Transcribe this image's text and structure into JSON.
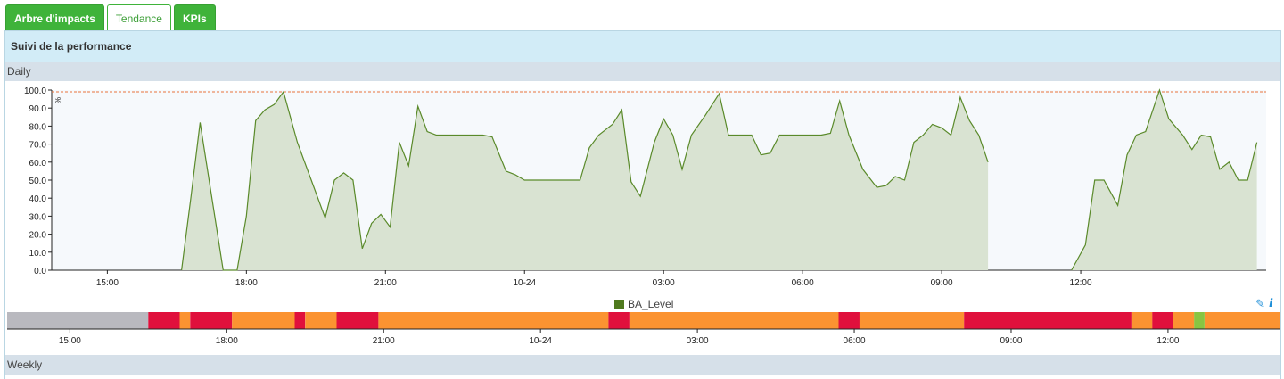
{
  "tabs": [
    {
      "label": "Arbre d'impacts"
    },
    {
      "label": "Tendance"
    },
    {
      "label": "KPIs"
    }
  ],
  "panel": {
    "title": "Suivi de la performance",
    "daily_label": "Daily",
    "weekly_label": "Weekly"
  },
  "colors": {
    "tab_green": "#3fb33a",
    "header_blue": "#d2ecf7",
    "series_line": "#5a8a2a",
    "series_fill": "#d9e3d2",
    "threshold": "#e8733c",
    "status_critical": "#e0103c",
    "status_warning": "#fb9331",
    "status_ok": "#88c542",
    "status_unknown": "#b9b9bf"
  },
  "tools": {
    "edit_icon": "pencil-icon",
    "info_icon": "info-icon",
    "info_glyph": "i"
  },
  "chart_data": {
    "type": "area",
    "title": "",
    "xlabel": "",
    "ylabel": "%",
    "ylim": [
      0,
      100
    ],
    "yticks": [
      "0.0",
      "10.0",
      "20.0",
      "30.0",
      "40.0",
      "50.0",
      "60.0",
      "70.0",
      "80.0",
      "90.0",
      "100.0"
    ],
    "xticks": [
      "15:00",
      "18:00",
      "21:00",
      "10-24",
      "03:00",
      "06:00",
      "09:00",
      "12:00"
    ],
    "threshold": 99,
    "legend": "BA_Level",
    "legend_position": "bottom-center",
    "grid": false,
    "series": [
      {
        "name": "BA_Level",
        "points": [
          [
            16.6,
            0
          ],
          [
            16.8,
            40
          ],
          [
            17.0,
            82
          ],
          [
            17.5,
            0
          ],
          [
            17.8,
            0
          ],
          [
            18.0,
            30
          ],
          [
            18.2,
            83
          ],
          [
            18.4,
            89
          ],
          [
            18.6,
            92
          ],
          [
            18.8,
            99
          ],
          [
            19.1,
            71
          ],
          [
            19.4,
            50
          ],
          [
            19.7,
            29
          ],
          [
            19.9,
            50
          ],
          [
            20.1,
            54
          ],
          [
            20.3,
            50
          ],
          [
            20.5,
            12
          ],
          [
            20.7,
            26
          ],
          [
            20.9,
            31
          ],
          [
            21.1,
            24
          ],
          [
            21.3,
            71
          ],
          [
            21.5,
            58
          ],
          [
            21.7,
            91
          ],
          [
            21.9,
            77
          ],
          [
            22.1,
            75
          ],
          [
            22.3,
            75
          ],
          [
            22.6,
            75
          ],
          [
            22.9,
            75
          ],
          [
            23.1,
            75
          ],
          [
            23.3,
            74
          ],
          [
            23.6,
            55
          ],
          [
            23.8,
            53
          ],
          [
            24.0,
            50
          ],
          [
            24.3,
            50
          ],
          [
            24.6,
            50
          ],
          [
            24.9,
            50
          ],
          [
            25.2,
            50
          ],
          [
            25.4,
            68
          ],
          [
            25.6,
            75
          ],
          [
            25.9,
            81
          ],
          [
            26.1,
            89
          ],
          [
            26.3,
            49
          ],
          [
            26.5,
            41
          ],
          [
            26.8,
            71
          ],
          [
            27.0,
            84
          ],
          [
            27.2,
            75
          ],
          [
            27.4,
            56
          ],
          [
            27.6,
            75
          ],
          [
            27.9,
            86
          ],
          [
            28.2,
            98
          ],
          [
            28.4,
            75
          ],
          [
            28.7,
            75
          ],
          [
            28.9,
            75
          ],
          [
            29.1,
            64
          ],
          [
            29.3,
            65
          ],
          [
            29.5,
            75
          ],
          [
            29.8,
            75
          ],
          [
            30.1,
            75
          ],
          [
            30.4,
            75
          ],
          [
            30.6,
            76
          ],
          [
            30.8,
            94
          ],
          [
            31.0,
            75
          ],
          [
            31.3,
            56
          ],
          [
            31.6,
            46
          ],
          [
            31.8,
            47
          ],
          [
            32.0,
            52
          ],
          [
            32.2,
            50
          ],
          [
            32.4,
            71
          ],
          [
            32.6,
            75
          ],
          [
            32.8,
            81
          ],
          [
            33.0,
            79
          ],
          [
            33.2,
            75
          ],
          [
            33.4,
            96
          ],
          [
            33.6,
            83
          ],
          [
            33.8,
            75
          ],
          [
            34.0,
            60
          ]
        ],
        "segments_break_after": 34.0,
        "points_2": [
          [
            35.8,
            0
          ],
          [
            36.1,
            14
          ],
          [
            36.3,
            50
          ],
          [
            36.5,
            50
          ],
          [
            36.8,
            36
          ],
          [
            37.0,
            64
          ],
          [
            37.2,
            75
          ],
          [
            37.4,
            77
          ],
          [
            37.7,
            100
          ],
          [
            37.9,
            84
          ],
          [
            38.2,
            75
          ],
          [
            38.4,
            67
          ],
          [
            38.6,
            75
          ],
          [
            38.8,
            74
          ],
          [
            39.0,
            56
          ],
          [
            39.2,
            60
          ],
          [
            39.4,
            50
          ],
          [
            39.6,
            50
          ],
          [
            39.8,
            71
          ]
        ]
      }
    ],
    "status_timeline": [
      {
        "from": 13.8,
        "to": 16.5,
        "status": "unknown"
      },
      {
        "from": 16.5,
        "to": 17.1,
        "status": "critical"
      },
      {
        "from": 17.1,
        "to": 17.3,
        "status": "warning"
      },
      {
        "from": 17.3,
        "to": 18.1,
        "status": "critical"
      },
      {
        "from": 18.1,
        "to": 19.3,
        "status": "warning"
      },
      {
        "from": 19.3,
        "to": 19.5,
        "status": "critical"
      },
      {
        "from": 19.5,
        "to": 20.1,
        "status": "warning"
      },
      {
        "from": 20.1,
        "to": 20.9,
        "status": "critical"
      },
      {
        "from": 20.9,
        "to": 25.3,
        "status": "warning"
      },
      {
        "from": 25.3,
        "to": 25.7,
        "status": "critical"
      },
      {
        "from": 25.7,
        "to": 29.7,
        "status": "warning"
      },
      {
        "from": 29.7,
        "to": 30.1,
        "status": "critical"
      },
      {
        "from": 30.1,
        "to": 32.1,
        "status": "warning"
      },
      {
        "from": 32.1,
        "to": 35.3,
        "status": "critical"
      },
      {
        "from": 35.3,
        "to": 35.7,
        "status": "warning"
      },
      {
        "from": 35.7,
        "to": 36.1,
        "status": "critical"
      },
      {
        "from": 36.1,
        "to": 36.5,
        "status": "warning"
      },
      {
        "from": 36.5,
        "to": 36.7,
        "status": "ok"
      },
      {
        "from": 36.7,
        "to": 38.15,
        "status": "warning"
      }
    ],
    "status_xticks": [
      "15:00",
      "18:00",
      "21:00",
      "10-24",
      "03:00",
      "06:00",
      "09:00",
      "12:00"
    ]
  }
}
